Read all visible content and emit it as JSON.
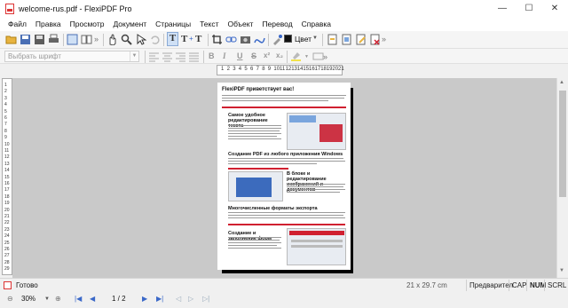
{
  "window": {
    "title": "welcome-rus.pdf - FlexiPDF Pro",
    "controls": {
      "minimize": "—",
      "maximize": "☐",
      "close": "✕"
    }
  },
  "menu": [
    "Файл",
    "Правка",
    "Просмотр",
    "Документ",
    "Страницы",
    "Текст",
    "Объект",
    "Перевод",
    "Справка"
  ],
  "toolbar": {
    "color_label": "Цвет",
    "overflow": "»"
  },
  "format_toolbar": {
    "font_placeholder": "Выбрать шрифт",
    "bold": "B",
    "italic": "I",
    "underline": "U",
    "strike": "S",
    "superscript": "x²",
    "subscript": "x₂",
    "overflow": "»"
  },
  "ruler": {
    "h_ticks": [
      "1",
      "2",
      "3",
      "4",
      "5",
      "6",
      "7",
      "8",
      "9",
      "10",
      "11",
      "12",
      "13",
      "14",
      "15",
      "16",
      "17",
      "18",
      "19",
      "20",
      "21"
    ],
    "v_ticks": [
      "1",
      "2",
      "3",
      "4",
      "5",
      "6",
      "7",
      "8",
      "9",
      "10",
      "11",
      "12",
      "13",
      "14",
      "15",
      "16",
      "17",
      "18",
      "19",
      "20",
      "21",
      "22",
      "23",
      "24",
      "25",
      "26",
      "27",
      "28",
      "29"
    ]
  },
  "document": {
    "heading": "FlexiPDF приветствует вас!",
    "section1_title": "Самое удобное редактирование текста",
    "section2_title": "Создание PDF из любого приложения Windows",
    "section3_title": "В блоке и редактирование изображений и документов",
    "section4_title": "Многочисленные форматы экспорта",
    "section5_title": "Создание и заполнение форм"
  },
  "status": {
    "text": "Готово",
    "page_size": "21 x 29.7 cm",
    "preview": "Предварител",
    "cap": "CAP",
    "num": "NUM",
    "scrl": "SCRL"
  },
  "nav": {
    "zoom": "30%",
    "page": "1 / 2"
  },
  "colors": {
    "accent": "#d02030",
    "nav_blue": "#3a68c8",
    "workspace": "#c9c9c9"
  }
}
